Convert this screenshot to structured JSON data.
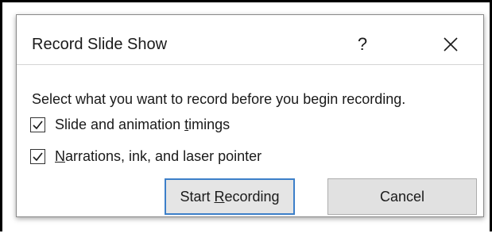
{
  "dialog": {
    "title": "Record Slide Show",
    "help_label": "?",
    "prompt": "Select what you want to record before you begin recording.",
    "options": [
      {
        "label_pre": "Slide and animation ",
        "label_accel": "t",
        "label_post": "imings",
        "checked": true
      },
      {
        "label_pre": "",
        "label_accel": "N",
        "label_post": "arrations, ink, and laser pointer",
        "checked": true
      }
    ],
    "start_button": {
      "label_pre": "Start ",
      "label_accel": "R",
      "label_post": "ecording"
    },
    "cancel_label": "Cancel"
  },
  "colors": {
    "default_button_border": "#3c7fc9",
    "button_face": "#e1e1e1",
    "frame_border": "#000000"
  }
}
